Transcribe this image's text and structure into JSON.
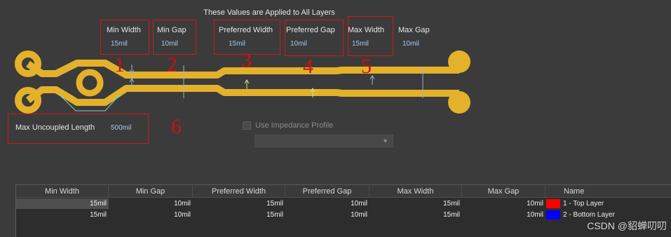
{
  "banner": "These Values are Applied to All Layers",
  "params": [
    {
      "label": "Min Width",
      "value": "15mil",
      "annotation": "1"
    },
    {
      "label": "Min Gap",
      "value": "10mil",
      "annotation": "2"
    },
    {
      "label": "Preferred Width",
      "value": "15mil",
      "annotation": "3"
    },
    {
      "label": "Preferred Gap",
      "value": "10mil",
      "annotation": "4"
    },
    {
      "label": "Max Width",
      "value": "15mil",
      "annotation": "5"
    },
    {
      "label": "Max Gap",
      "value": "10mil"
    }
  ],
  "uncoupled": {
    "label": "Max Uncoupled Length",
    "value": "500mil",
    "annotation": "6"
  },
  "impedance": {
    "checkbox_label": "Use Impedance Profile",
    "checked": false,
    "selected": ""
  },
  "table": {
    "columns": [
      "Min Width",
      "Min Gap",
      "Preferred Width",
      "Preferred Gap",
      "Max Width",
      "Max Gap",
      "Name"
    ],
    "rows": [
      {
        "cells": [
          "15mil",
          "10mil",
          "15mil",
          "10mil",
          "15mil",
          "10mil"
        ],
        "name": "1 - Top Layer",
        "color": "#ff0000"
      },
      {
        "cells": [
          "15mil",
          "10mil",
          "15mil",
          "10mil",
          "15mil",
          "10mil"
        ],
        "name": "2 - Bottom Layer",
        "color": "#0000ff"
      }
    ]
  },
  "colors": {
    "trace": "#e3b22a",
    "annotation_red": "#d01010",
    "value_blue": "#9fc7f0"
  },
  "watermark": "CSDN @貂蝉叨叨"
}
